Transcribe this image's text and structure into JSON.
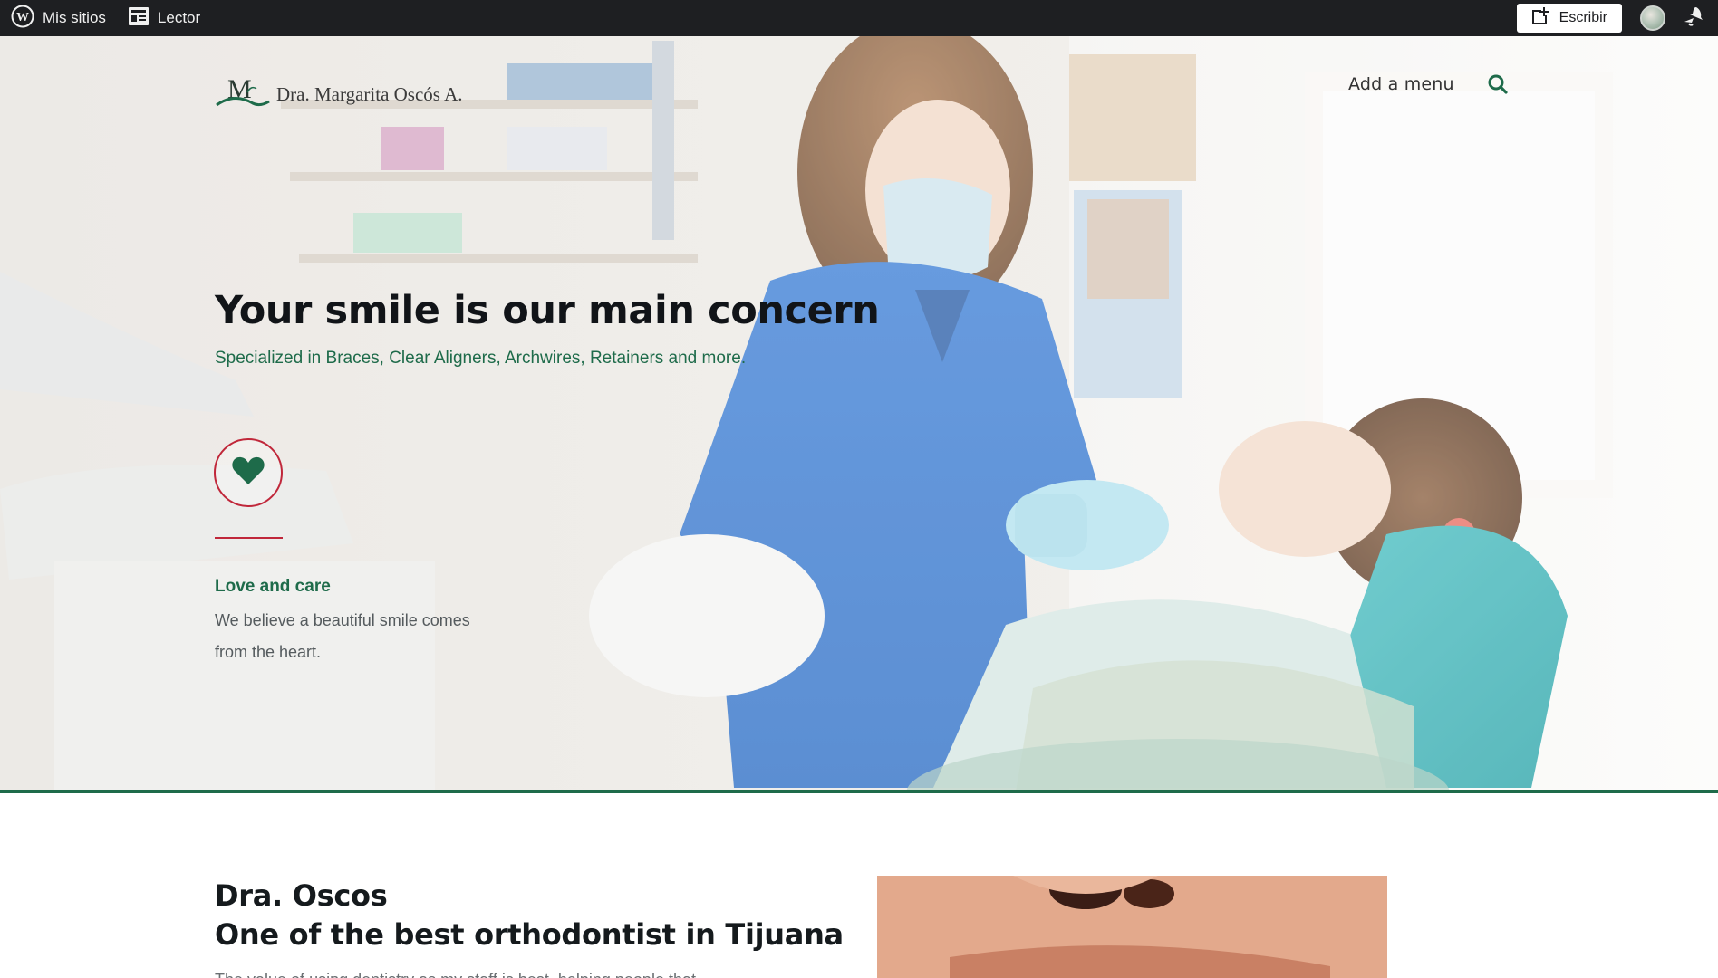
{
  "admin_bar": {
    "my_sites_label": "Mis sitios",
    "reader_label": "Lector",
    "write_label": "Escribir",
    "icons": [
      "wordpress-logo-icon",
      "reader-icon",
      "write-post-icon",
      "avatar",
      "notifications-bell-icon"
    ]
  },
  "site": {
    "name": "Dra. Margarita Oscós A.",
    "menu_label": "Add a menu"
  },
  "hero": {
    "title": "Your smile is our main concern",
    "subtitle": "Specialized in Braces, Clear Aligners, Archwires, Retainers and more.",
    "feature_title": "Love and care",
    "feature_text": "We believe a beautiful smile comes from the heart."
  },
  "about": {
    "title_line1": "Dra. Oscos",
    "title_line2": "One of the best orthodontist in Tijuana",
    "body": "The value of using dentistry as my staff is best, helping people that"
  },
  "colors": {
    "admin_bar_bg": "#1e1f22",
    "brand_green": "#1e6b4a",
    "accent_red": "#c0273a",
    "heading_dark": "#111418"
  }
}
